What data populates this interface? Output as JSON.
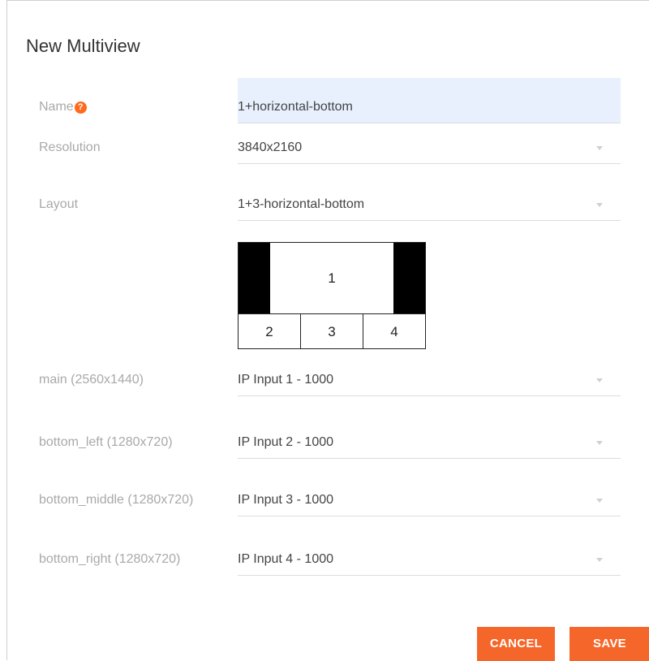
{
  "dialog": {
    "title": "New Multiview"
  },
  "form": {
    "name": {
      "label": "Name",
      "help_icon": "?",
      "value": "1+horizontal-bottom"
    },
    "resolution": {
      "label": "Resolution",
      "value": "3840x2160"
    },
    "layout": {
      "label": "Layout",
      "value": "1+3-horizontal-bottom"
    },
    "main": {
      "label": "main (2560x1440)",
      "value": "IP Input 1 - 1000"
    },
    "bottom_left": {
      "label": "bottom_left (1280x720)",
      "value": "IP Input 2 - 1000"
    },
    "bottom_middle": {
      "label": "bottom_middle (1280x720)",
      "value": "IP Input 3 - 1000"
    },
    "bottom_right": {
      "label": "bottom_right (1280x720)",
      "value": "IP Input 4 - 1000"
    }
  },
  "layout_preview": {
    "main": "1",
    "cells": [
      "2",
      "3",
      "4"
    ]
  },
  "buttons": {
    "cancel": "CANCEL",
    "save": "SAVE"
  },
  "colors": {
    "accent": "#f5662a",
    "autofill_bg": "#e8f0fe"
  },
  "icons": {
    "help": "help-circle-icon",
    "dropdown": "chevron-down-icon"
  }
}
